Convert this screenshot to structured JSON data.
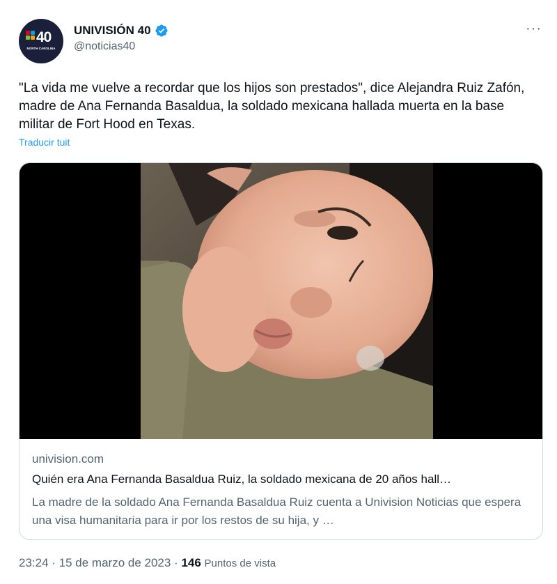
{
  "account": {
    "display_name": "UNIVISIÓN 40",
    "handle": "@noticias40",
    "avatar_text": "40",
    "avatar_subtext": "NORTH CAROLINA",
    "verified_color": "#1d9bf0"
  },
  "more_label": "···",
  "tweet": {
    "text": "\"La vida me vuelve a recordar que los hijos son prestados\", dice Alejandra Ruiz Zafón, madre de Ana Fernanda Basaldua, la soldado mexicana hallada muerta en la base militar de Fort Hood en Texas.",
    "translate_label": "Traducir tuit"
  },
  "card": {
    "domain": "univision.com",
    "title": "Quién era Ana Fernanda Basaldua Ruiz, la soldado mexicana de 20 años hall…",
    "description": "La madre de la soldado Ana Fernanda Basaldua Ruiz cuenta a Univision Noticias que espera una visa humanitaria para ir por los restos de su hija, y …"
  },
  "meta": {
    "time": "23:24",
    "sep1": " · ",
    "date": "15 de marzo de 2023",
    "sep2": " · ",
    "views": "146",
    "views_label": "Puntos de vista"
  }
}
